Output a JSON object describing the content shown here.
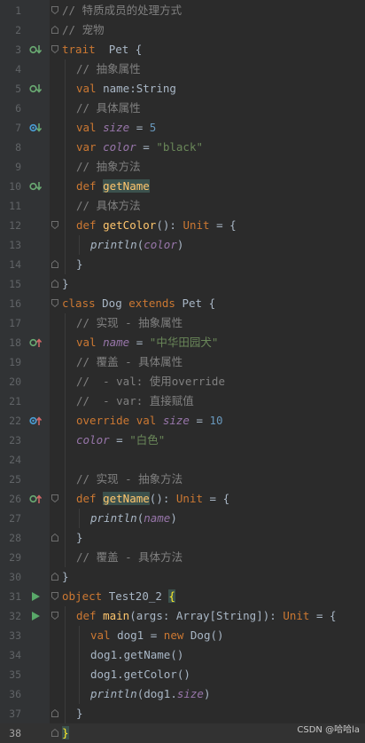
{
  "editor": {
    "lines": [
      {
        "n": "1",
        "marker": "",
        "fold": "open-top",
        "indent": 0,
        "tokens": [
          [
            "cm",
            "// 特质成员的处理方式"
          ]
        ]
      },
      {
        "n": "2",
        "marker": "",
        "fold": "close",
        "indent": 0,
        "tokens": [
          [
            "cm",
            "// 宠物"
          ]
        ]
      },
      {
        "n": "3",
        "marker": "impl-down",
        "fold": "open",
        "indent": 0,
        "tokens": [
          [
            "kw",
            "trait"
          ],
          [
            "",
            "  Pet {"
          ]
        ]
      },
      {
        "n": "4",
        "marker": "",
        "fold": "",
        "indent": 1,
        "tokens": [
          [
            "cm",
            "// 抽象属性"
          ]
        ]
      },
      {
        "n": "5",
        "marker": "impl-down",
        "fold": "",
        "indent": 1,
        "tokens": [
          [
            "kw",
            "val "
          ],
          [
            "",
            "name:String"
          ]
        ]
      },
      {
        "n": "6",
        "marker": "",
        "fold": "",
        "indent": 1,
        "tokens": [
          [
            "cm",
            "// 具体属性"
          ]
        ]
      },
      {
        "n": "7",
        "marker": "over-down",
        "fold": "",
        "indent": 1,
        "tokens": [
          [
            "kw",
            "val "
          ],
          [
            "fld it",
            "size"
          ],
          [
            "",
            " = "
          ],
          [
            "num",
            "5"
          ]
        ]
      },
      {
        "n": "8",
        "marker": "",
        "fold": "",
        "indent": 1,
        "tokens": [
          [
            "kw",
            "var "
          ],
          [
            "fld it",
            "color"
          ],
          [
            "",
            " = "
          ],
          [
            "str",
            "\"black\""
          ]
        ]
      },
      {
        "n": "9",
        "marker": "",
        "fold": "",
        "indent": 1,
        "tokens": [
          [
            "cm",
            "// 抽象方法"
          ]
        ]
      },
      {
        "n": "10",
        "marker": "impl-down",
        "fold": "",
        "indent": 1,
        "tokens": [
          [
            "kw",
            "def "
          ],
          [
            "fn hl",
            "getName"
          ]
        ]
      },
      {
        "n": "11",
        "marker": "",
        "fold": "",
        "indent": 1,
        "tokens": [
          [
            "cm",
            "// 具体方法"
          ]
        ]
      },
      {
        "n": "12",
        "marker": "",
        "fold": "open",
        "indent": 1,
        "tokens": [
          [
            "kw",
            "def "
          ],
          [
            "fn",
            "getColor"
          ],
          [
            "",
            "(): "
          ],
          [
            "kw",
            "Unit"
          ],
          [
            "",
            " = {"
          ]
        ]
      },
      {
        "n": "13",
        "marker": "",
        "fold": "",
        "indent": 2,
        "tokens": [
          [
            "it",
            "println"
          ],
          [
            "",
            "("
          ],
          [
            "fld it",
            "color"
          ],
          [
            "",
            ")"
          ]
        ]
      },
      {
        "n": "14",
        "marker": "",
        "fold": "close",
        "indent": 1,
        "tokens": [
          [
            "",
            "}"
          ]
        ]
      },
      {
        "n": "15",
        "marker": "",
        "fold": "close",
        "indent": 0,
        "tokens": [
          [
            "",
            "}"
          ]
        ]
      },
      {
        "n": "16",
        "marker": "",
        "fold": "open",
        "indent": 0,
        "tokens": [
          [
            "kw",
            "class "
          ],
          [
            "",
            "Dog "
          ],
          [
            "kw",
            "extends "
          ],
          [
            "",
            "Pet {"
          ]
        ]
      },
      {
        "n": "17",
        "marker": "",
        "fold": "",
        "indent": 1,
        "tokens": [
          [
            "cm",
            "// 实现 - 抽象属性"
          ]
        ]
      },
      {
        "n": "18",
        "marker": "impl-up",
        "fold": "",
        "indent": 1,
        "tokens": [
          [
            "kw",
            "val "
          ],
          [
            "fld it",
            "name"
          ],
          [
            "",
            " = "
          ],
          [
            "str",
            "\"中华田园犬\""
          ]
        ]
      },
      {
        "n": "19",
        "marker": "",
        "fold": "",
        "indent": 1,
        "tokens": [
          [
            "cm",
            "// 覆盖 - 具体属性"
          ]
        ]
      },
      {
        "n": "20",
        "marker": "",
        "fold": "",
        "indent": 1,
        "tokens": [
          [
            "cm",
            "//  - val: 使用override"
          ]
        ]
      },
      {
        "n": "21",
        "marker": "",
        "fold": "",
        "indent": 1,
        "tokens": [
          [
            "cm",
            "//  - var: 直接赋值"
          ]
        ]
      },
      {
        "n": "22",
        "marker": "over-up",
        "fold": "",
        "indent": 1,
        "tokens": [
          [
            "kw",
            "override val "
          ],
          [
            "fld it",
            "size"
          ],
          [
            "",
            " = "
          ],
          [
            "num",
            "10"
          ]
        ]
      },
      {
        "n": "23",
        "marker": "",
        "fold": "",
        "indent": 1,
        "tokens": [
          [
            "fld it",
            "color"
          ],
          [
            "",
            " = "
          ],
          [
            "str",
            "\"白色\""
          ]
        ]
      },
      {
        "n": "24",
        "marker": "",
        "fold": "",
        "indent": 1,
        "tokens": []
      },
      {
        "n": "25",
        "marker": "",
        "fold": "",
        "indent": 1,
        "tokens": [
          [
            "cm",
            "// 实现 - 抽象方法"
          ]
        ]
      },
      {
        "n": "26",
        "marker": "impl-up",
        "fold": "open",
        "indent": 1,
        "tokens": [
          [
            "kw",
            "def "
          ],
          [
            "fn hl",
            "getName"
          ],
          [
            "",
            "(): "
          ],
          [
            "kw",
            "Unit"
          ],
          [
            "",
            " = {"
          ]
        ]
      },
      {
        "n": "27",
        "marker": "",
        "fold": "",
        "indent": 2,
        "tokens": [
          [
            "it",
            "println"
          ],
          [
            "",
            "("
          ],
          [
            "fld it",
            "name"
          ],
          [
            "",
            ")"
          ]
        ]
      },
      {
        "n": "28",
        "marker": "",
        "fold": "close",
        "indent": 1,
        "tokens": [
          [
            "",
            "}"
          ]
        ]
      },
      {
        "n": "29",
        "marker": "",
        "fold": "",
        "indent": 1,
        "tokens": [
          [
            "cm",
            "// 覆盖 - 具体方法"
          ]
        ]
      },
      {
        "n": "30",
        "marker": "",
        "fold": "close",
        "indent": 0,
        "tokens": [
          [
            "",
            "}"
          ]
        ]
      },
      {
        "n": "31",
        "marker": "run",
        "fold": "open",
        "indent": 0,
        "tokens": [
          [
            "kw",
            "object "
          ],
          [
            "",
            "Test20_2 "
          ],
          [
            "brace-hl",
            "{"
          ]
        ]
      },
      {
        "n": "32",
        "marker": "run",
        "fold": "open",
        "indent": 1,
        "tokens": [
          [
            "kw",
            "def "
          ],
          [
            "fn",
            "main"
          ],
          [
            "",
            "(args: Array[String]): "
          ],
          [
            "kw",
            "Unit"
          ],
          [
            "",
            " = {"
          ]
        ]
      },
      {
        "n": "33",
        "marker": "",
        "fold": "",
        "indent": 2,
        "tokens": [
          [
            "kw",
            "val "
          ],
          [
            "",
            "dog1 = "
          ],
          [
            "kw",
            "new "
          ],
          [
            "",
            "Dog()"
          ]
        ]
      },
      {
        "n": "34",
        "marker": "",
        "fold": "",
        "indent": 2,
        "tokens": [
          [
            "",
            "dog1.getName()"
          ]
        ]
      },
      {
        "n": "35",
        "marker": "",
        "fold": "",
        "indent": 2,
        "tokens": [
          [
            "",
            "dog1.getColor()"
          ]
        ]
      },
      {
        "n": "36",
        "marker": "",
        "fold": "",
        "indent": 2,
        "tokens": [
          [
            "it",
            "println"
          ],
          [
            "",
            "(dog1."
          ],
          [
            "fld it",
            "size"
          ],
          [
            "",
            ")"
          ]
        ]
      },
      {
        "n": "37",
        "marker": "",
        "fold": "close",
        "indent": 1,
        "tokens": [
          [
            "",
            "}"
          ]
        ]
      },
      {
        "n": "38",
        "marker": "",
        "fold": "close",
        "indent": 0,
        "tokens": [
          [
            "brace-hl",
            "}"
          ]
        ],
        "current": true
      }
    ]
  },
  "watermark": {
    "text": "CSDN @哈哈la"
  },
  "colors": {
    "keyword": "#cc7832",
    "comment": "#808080",
    "string": "#6a8759",
    "number": "#6897bb",
    "field": "#9876aa",
    "function": "#ffc66d",
    "text": "#a9b7c6",
    "background": "#2b2b2b",
    "gutter": "#313335",
    "implemented_marker": "#6aab73",
    "overriding_marker": "#4a9ed6",
    "up_arrow": "#d16868",
    "run_icon": "#59a869"
  }
}
